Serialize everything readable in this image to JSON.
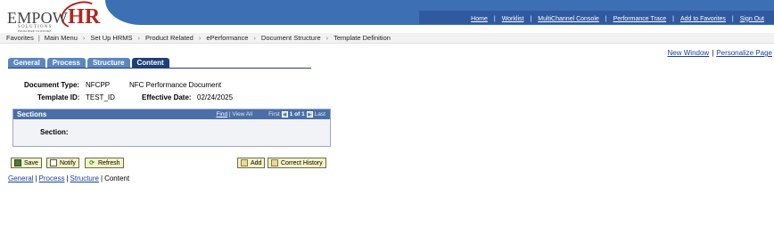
{
  "logo": {
    "main": "EMPOW",
    "accent": "HR",
    "sub": "SOLUTIONS",
    "tagline": "FROM HIRE TO RETIRE"
  },
  "header_links": [
    "Home",
    "Worklist",
    "MultiChannel Console",
    "Performance Trace",
    "Add to Favorites",
    "Sign Out"
  ],
  "navbar": {
    "favorites": "Favorites",
    "main_menu": "Main Menu",
    "path": [
      "Set Up HRMS",
      "Product Related",
      "ePerformance",
      "Document Structure",
      "Template Definition"
    ]
  },
  "top_links": {
    "new_window": "New Window",
    "personalize": "Personalize Page"
  },
  "tabs": [
    {
      "label": "General",
      "active": false
    },
    {
      "label": "Process",
      "active": false
    },
    {
      "label": "Structure",
      "active": false
    },
    {
      "label": "Content",
      "active": true
    }
  ],
  "form": {
    "document_type_label": "Document Type:",
    "document_type_value": "NFCPP",
    "document_type_desc": "NFC Performance Document",
    "template_id_label": "Template ID:",
    "template_id_value": "TEST_ID",
    "effective_date_label": "Effective Date:",
    "effective_date_value": "02/24/2025"
  },
  "sections": {
    "title": "Sections",
    "find": "Find",
    "view_all": "View All",
    "first": "First",
    "count": "1 of 1",
    "last": "Last",
    "section_label": "Section:"
  },
  "buttons": {
    "save": "Save",
    "notify": "Notify",
    "refresh": "Refresh",
    "add": "Add",
    "correct_history": "Correct History"
  },
  "page_links": {
    "general": "General",
    "process": "Process",
    "structure": "Structure",
    "content": "Content"
  },
  "colors": {
    "banner": "#3d6fb5",
    "tab": "#5b86c2",
    "tab_active": "#1f3f77",
    "grid_header": "#4a6fa8",
    "button_bg": "#f5f2c6",
    "link": "#1a3f9a",
    "logo_accent": "#b0271f"
  }
}
